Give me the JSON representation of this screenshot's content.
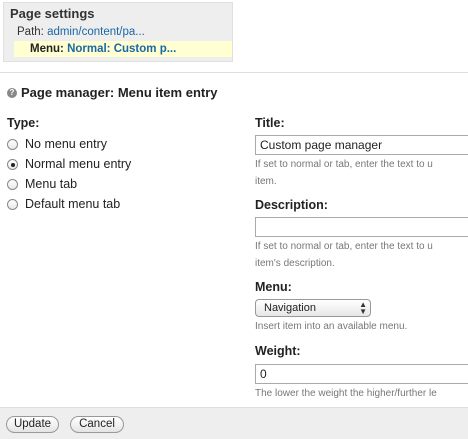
{
  "page_settings": {
    "title": "Page settings",
    "path_label": "Path:",
    "path_value": "admin/content/pa...",
    "menu_label": "Menu:",
    "menu_value": "Normal: Custom p..."
  },
  "section": {
    "help_icon": "?",
    "title": "Page manager: Menu item entry"
  },
  "type": {
    "label": "Type:",
    "options": [
      {
        "label": "No menu entry",
        "checked": false
      },
      {
        "label": "Normal menu entry",
        "checked": true
      },
      {
        "label": "Menu tab",
        "checked": false
      },
      {
        "label": "Default menu tab",
        "checked": false
      }
    ]
  },
  "title_field": {
    "label": "Title:",
    "value": "Custom page manager",
    "help": "If set to normal or tab, enter the text to u",
    "help2": "item."
  },
  "description_field": {
    "label": "Description:",
    "value": "",
    "help": "If set to normal or tab, enter the text to u",
    "help2": "item's description."
  },
  "menu_field": {
    "label": "Menu:",
    "selected": "Navigation",
    "help": "Insert item into an available menu."
  },
  "weight_field": {
    "label": "Weight:",
    "value": "0",
    "help": "The lower the weight the higher/further le"
  },
  "buttons": {
    "update": "Update",
    "cancel": "Cancel"
  }
}
